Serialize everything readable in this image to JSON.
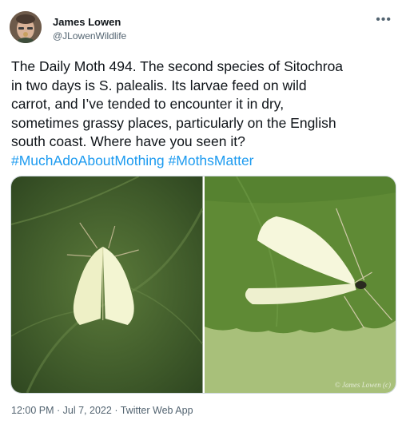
{
  "author": {
    "display_name": "James Lowen",
    "handle": "@JLowenWildlife"
  },
  "more_icon": "more-horizontal-icon",
  "tweet_lines": [
    "The Daily Moth 494. The second species of Sitochroa",
    "in two days is S. palealis. Its larvae feed on wild",
    "carrot, and I’ve tended to encounter it in dry,",
    "sometimes grassy places, particularly on the English",
    "south coast. Where have you seen it?"
  ],
  "hashtags": [
    "#MuchAdoAboutMothing",
    "#MothsMatter"
  ],
  "media": {
    "photo_count": 2,
    "watermark": "© James Lowen (c)"
  },
  "meta": {
    "time": "12:00 PM",
    "separator": "·",
    "date": "Jul 7, 2022",
    "source": "Twitter Web App"
  },
  "colors": {
    "link": "#1d9bf0",
    "secondary_text": "#536471",
    "border": "#cfd9de"
  }
}
